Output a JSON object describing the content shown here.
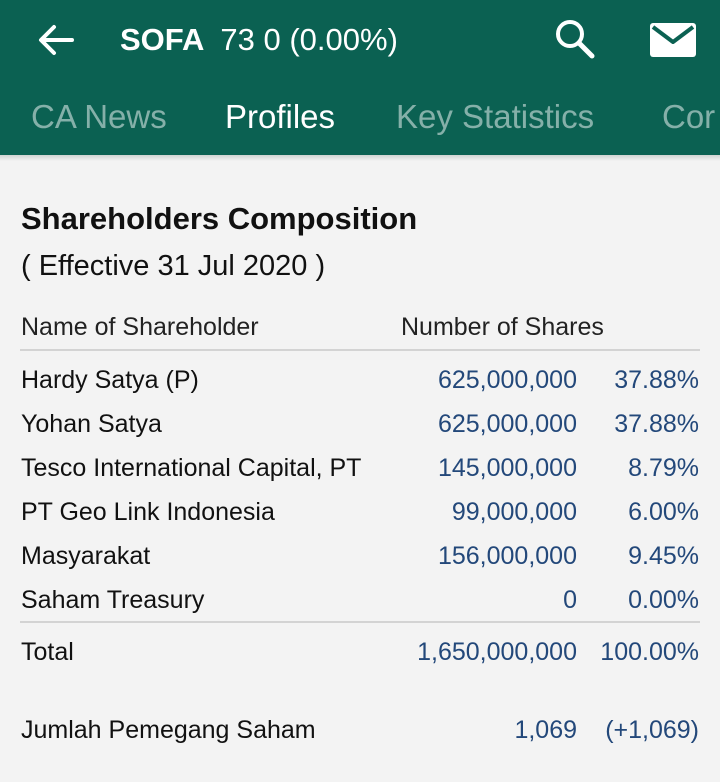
{
  "header": {
    "ticker": "SOFA",
    "quote": "73 0 (0.00%)",
    "back_icon": "arrow-left-icon",
    "search_icon": "search-icon",
    "mail_icon": "mail-icon",
    "background_color": "#0b6152"
  },
  "tabs": [
    {
      "label": "CA News",
      "active": false
    },
    {
      "label": "Profiles",
      "active": true
    },
    {
      "label": "Key Statistics",
      "active": false
    },
    {
      "label": "Cor",
      "active": false
    }
  ],
  "section": {
    "title": "Shareholders Composition",
    "effective": "( Effective 31 Jul 2020 )",
    "col_name": "Name of Shareholder",
    "col_shares": "Number of Shares"
  },
  "shareholders": [
    {
      "name": "Hardy Satya (P)",
      "shares": "625,000,000",
      "pct": "37.88%"
    },
    {
      "name": "Yohan Satya",
      "shares": "625,000,000",
      "pct": "37.88%"
    },
    {
      "name": "Tesco International Capital, PT",
      "shares": "145,000,000",
      "pct": "8.79%"
    },
    {
      "name": "PT Geo Link Indonesia",
      "shares": "99,000,000",
      "pct": "6.00%"
    },
    {
      "name": "Masyarakat",
      "shares": "156,000,000",
      "pct": "9.45%"
    },
    {
      "name": "Saham Treasury",
      "shares": "0",
      "pct": "0.00%"
    }
  ],
  "total": {
    "label": "Total",
    "shares": "1,650,000,000",
    "pct": "100.00%"
  },
  "holders": {
    "label": "Jumlah Pemegang Saham",
    "count": "1,069",
    "change": "(+1,069)"
  },
  "colors": {
    "value_text": "#23487a"
  }
}
